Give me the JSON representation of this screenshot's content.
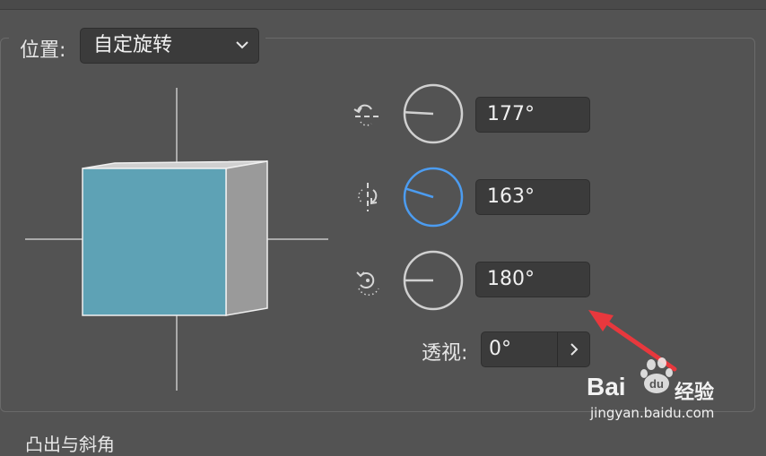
{
  "position": {
    "label": "位置:",
    "selected": "自定旋转"
  },
  "rotation": {
    "x": {
      "value": "177°",
      "angle_deg": 177
    },
    "y": {
      "value": "163°",
      "angle_deg": 163
    },
    "z": {
      "value": "180°",
      "angle_deg": 180
    }
  },
  "perspective": {
    "label": "透视:",
    "value": "0°"
  },
  "next_section": {
    "label": "凸出与斜角"
  },
  "watermark": {
    "brand": "Bai",
    "brand_cn": "经验",
    "url": "jingyan.baidu.com"
  },
  "icons": {
    "select": "chevron-down-icon",
    "x_axis": "rotate-x-axis-icon",
    "y_axis": "rotate-y-axis-icon",
    "z_axis": "rotate-z-axis-icon",
    "perspective": "chevron-right-icon"
  },
  "colors": {
    "accent": "#4c9cf0",
    "cube_front": "#5ea2b5",
    "cube_side": "#9a9a9a",
    "cube_top": "#d0d0d0",
    "arrow": "#e8383d"
  }
}
